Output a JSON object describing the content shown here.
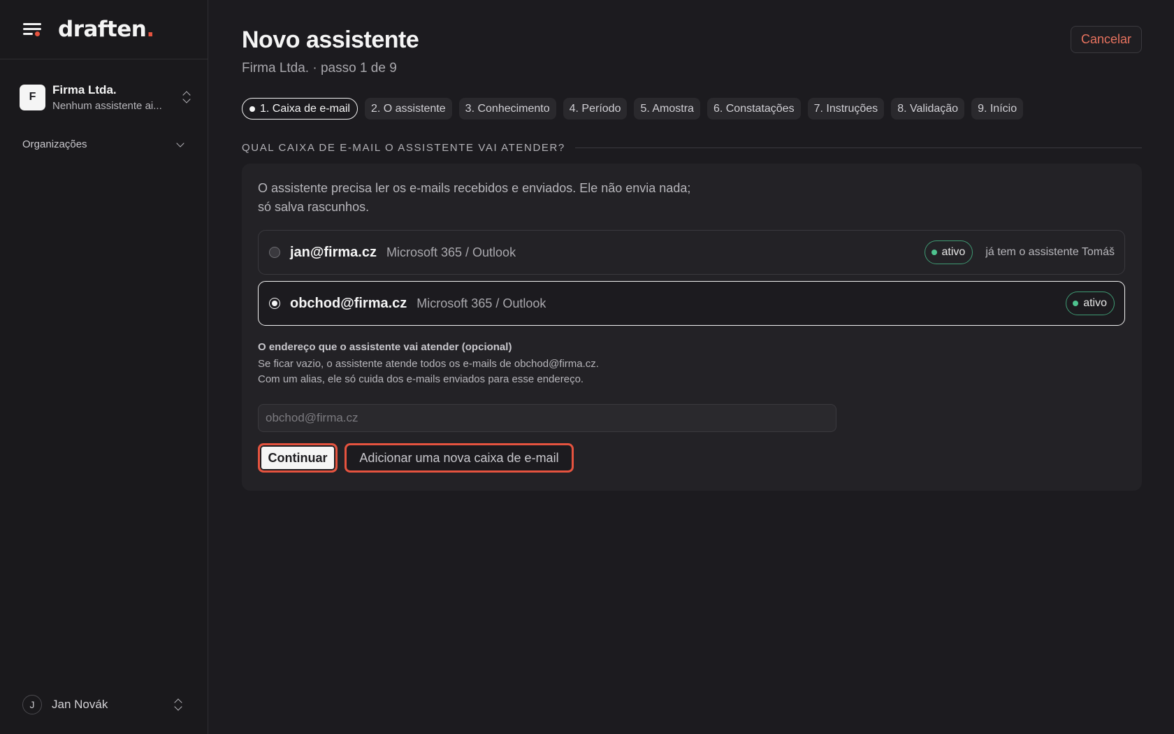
{
  "brand": {
    "logo_text": "draften",
    "logo_dot": "."
  },
  "sidebar": {
    "org": {
      "avatar_letter": "F",
      "name": "Firma Ltda.",
      "subtitle": "Nenhum assistente ai..."
    },
    "section_label": "Organizações",
    "user": {
      "avatar_letter": "J",
      "name": "Jan Novák"
    }
  },
  "header": {
    "title": "Novo assistente",
    "subtitle": "Firma Ltda. · passo 1 de 9",
    "cancel_label": "Cancelar"
  },
  "steps": [
    {
      "label": "1. Caixa de e-mail",
      "active": true
    },
    {
      "label": "2. O assistente"
    },
    {
      "label": "3. Conhecimento"
    },
    {
      "label": "4. Período"
    },
    {
      "label": "5. Amostra"
    },
    {
      "label": "6. Constatações"
    },
    {
      "label": "7. Instruções"
    },
    {
      "label": "8. Validação"
    },
    {
      "label": "9. Início"
    }
  ],
  "section": {
    "heading": "QUAL CAIXA DE E-MAIL O ASSISTENTE VAI ATENDER?",
    "intro": "O assistente precisa ler os e-mails recebidos e enviados. Ele não envia nada; só salva rascunhos."
  },
  "mailboxes": [
    {
      "email": "jan@firma.cz",
      "provider": "Microsoft 365 / Outlook",
      "status": "ativo",
      "note": "já tem o assistente Tomáš",
      "selected": false
    },
    {
      "email": "obchod@firma.cz",
      "provider": "Microsoft 365 / Outlook",
      "status": "ativo",
      "selected": true
    }
  ],
  "alias_field": {
    "label": "O endereço que o assistente vai atender (opcional)",
    "help": "Se ficar vazio, o assistente atende todos os e-mails de obchod@firma.cz. Com um alias, ele só cuida dos e-mails enviados para esse endereço.",
    "placeholder": "obchod@firma.cz",
    "value": ""
  },
  "actions": {
    "continue_label": "Continuar",
    "add_mailbox_label": "Adicionar uma nova caixa de e-mail"
  },
  "colors": {
    "accent": "#e5533f",
    "status_green": "#4ec38f",
    "background": "#1c1b1f"
  }
}
